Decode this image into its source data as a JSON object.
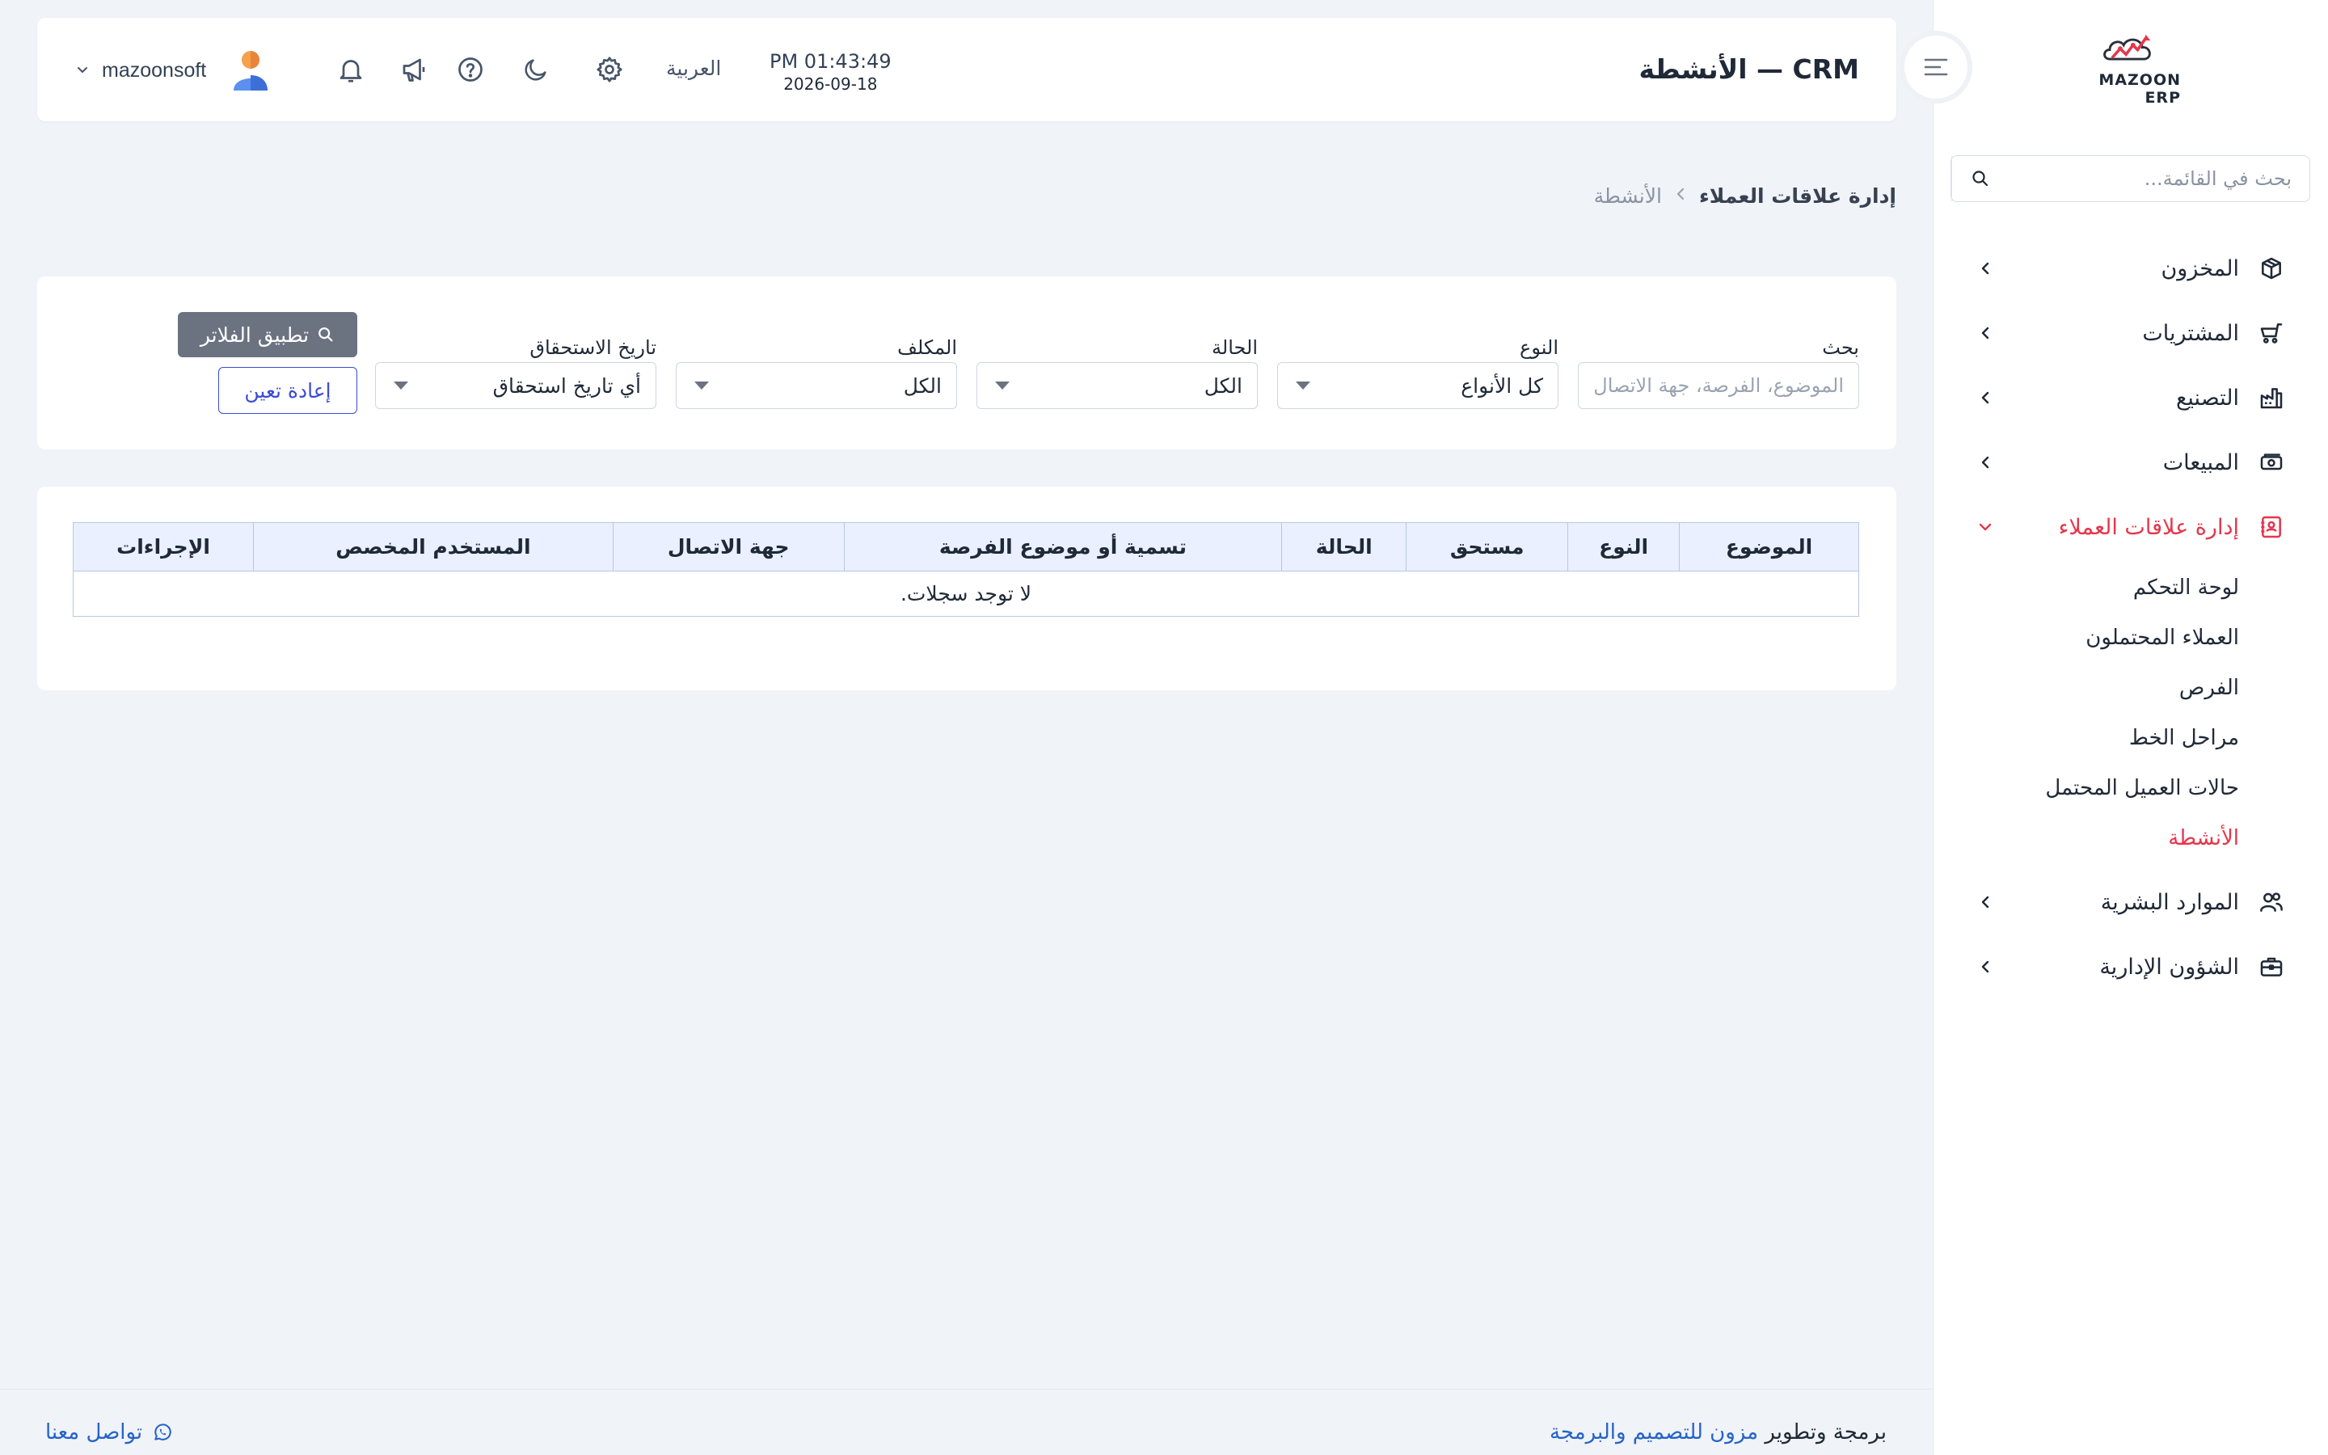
{
  "brand": {
    "name": "MAZOON ERP",
    "accent": "#e5364b"
  },
  "sidebar": {
    "search_placeholder": "بحث في القائمة...",
    "items": [
      {
        "label": "المخزون",
        "icon": "box-icon"
      },
      {
        "label": "المشتريات",
        "icon": "cart-icon"
      },
      {
        "label": "التصنيع",
        "icon": "factory-icon"
      },
      {
        "label": "المبيعات",
        "icon": "cash-icon"
      },
      {
        "label": "إدارة علاقات العملاء",
        "icon": "contact-book-icon",
        "expanded": true
      },
      {
        "label": "الموارد البشرية",
        "icon": "users-icon"
      },
      {
        "label": "الشؤون الإدارية",
        "icon": "briefcase-icon"
      }
    ],
    "crm_sub": [
      {
        "label": "لوحة التحكم"
      },
      {
        "label": "العملاء المحتملون"
      },
      {
        "label": "الفرص"
      },
      {
        "label": "مراحل الخط"
      },
      {
        "label": "حالات العميل المحتمل"
      },
      {
        "label": "الأنشطة",
        "active": true
      }
    ]
  },
  "topbar": {
    "title": "CRM — الأنشطة",
    "time": "PM 01:43:49",
    "date": "2026-09-18",
    "language": "العربية",
    "username": "mazoonsoft"
  },
  "breadcrumb": {
    "root": "إدارة علاقات العملاء",
    "current": "الأنشطة"
  },
  "filters": {
    "search": {
      "label": "بحث",
      "placeholder": "الموضوع، الفرصة، جهة الاتصال"
    },
    "type": {
      "label": "النوع",
      "value": "كل الأنواع"
    },
    "status": {
      "label": "الحالة",
      "value": "الكل"
    },
    "assignee": {
      "label": "المكلف",
      "value": "الكل"
    },
    "due_date": {
      "label": "تاريخ الاستحقاق",
      "value": "أي تاريخ استحقاق"
    },
    "apply_label": "تطبيق الفلاتر",
    "reset_label": "إعادة تعين"
  },
  "table": {
    "columns": [
      "الموضوع",
      "النوع",
      "مستحق",
      "الحالة",
      "تسمية أو موضوع الفرصة",
      "جهة الاتصال",
      "المستخدم المخصص",
      "الإجراءات"
    ],
    "empty_text": "لا توجد سجلات."
  },
  "footer": {
    "credit_prefix": "برمجة وتطوير",
    "credit_link": "مزون للتصميم والبرمجة",
    "contact": "تواصل معنا"
  }
}
